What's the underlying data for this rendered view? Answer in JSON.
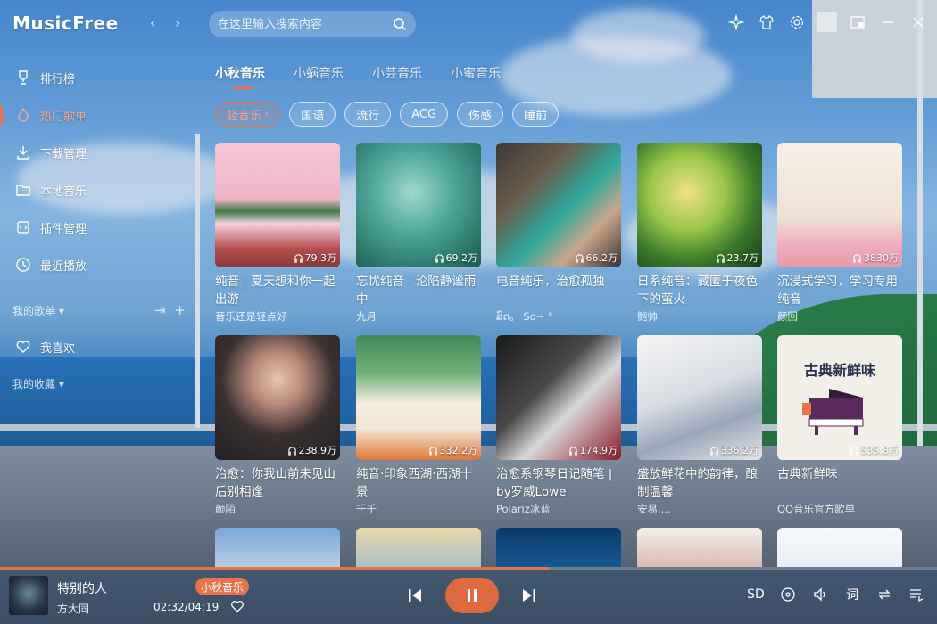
{
  "app": {
    "title": "MusicFree"
  },
  "search": {
    "placeholder": "在这里输入搜索内容"
  },
  "sidebar": {
    "items": [
      {
        "label": "排行榜",
        "icon": "trophy-icon"
      },
      {
        "label": "热门歌单",
        "icon": "flame-icon",
        "active": true
      },
      {
        "label": "下载管理",
        "icon": "download-icon"
      },
      {
        "label": "本地音乐",
        "icon": "folder-icon"
      },
      {
        "label": "插件管理",
        "icon": "plugin-icon"
      },
      {
        "label": "最近播放",
        "icon": "clock-icon"
      }
    ],
    "my_playlists_label": "我的歌单",
    "favorites_label": "我喜欢",
    "my_collections_label": "我的收藏"
  },
  "tabs": [
    {
      "label": "小秋音乐",
      "active": true
    },
    {
      "label": "小蜗音乐"
    },
    {
      "label": "小芸音乐"
    },
    {
      "label": "小蜜音乐"
    }
  ],
  "tags": [
    {
      "label": "轻音乐",
      "active": true,
      "has_arrow": true
    },
    {
      "label": "国语"
    },
    {
      "label": "流行"
    },
    {
      "label": "ACG"
    },
    {
      "label": "伤感"
    },
    {
      "label": "睡前"
    }
  ],
  "playlists": [
    {
      "title": "纯音 | 夏天想和你一起出游",
      "author": "音乐还是轻点好",
      "plays": "79.3万"
    },
    {
      "title": "忘忧纯音 · 沦陷静谧雨中",
      "author": "九月",
      "plays": "69.2万"
    },
    {
      "title": "电音纯乐，治愈孤独",
      "author": "ລົດ。 So~ °",
      "plays": "66.2万"
    },
    {
      "title": "日系纯音：藏匿于夜色下的萤火",
      "author": "鲍帅",
      "plays": "23.7万"
    },
    {
      "title": "沉浸式学习，学习专用纯音",
      "author": "颜回",
      "plays": "3830万"
    },
    {
      "title": "治愈：你我山前未见山后别相逢",
      "author": "颜陌",
      "plays": "238.9万"
    },
    {
      "title": "纯音·印象西湖·西湖十景",
      "author": "千千",
      "plays": "332.2万"
    },
    {
      "title": "治愈系钢琴日记随笔 | by罗威Lowe",
      "author": "Polariz冰蓝",
      "plays": "174.9万"
    },
    {
      "title": "盛放鲜花中的韵律，酿制温馨",
      "author": "安易....",
      "plays": "336.2万"
    },
    {
      "title": "古典新鲜味",
      "author": "QQ音乐官方歌单",
      "plays": "535.8万",
      "cover_text": "古典新鲜味"
    },
    {
      "title": "",
      "author": "",
      "plays": ""
    },
    {
      "title": "",
      "author": "",
      "plays": ""
    },
    {
      "title": "",
      "author": "",
      "plays": ""
    },
    {
      "title": "",
      "author": "",
      "plays": ""
    },
    {
      "title": "",
      "author": "",
      "plays": ""
    }
  ],
  "player": {
    "song_title": "特别的人",
    "artist": "方大同",
    "source": "小秋音乐",
    "time": "02:32/04:19",
    "progress": 0.586,
    "quality": "SD",
    "lyric_label": "词"
  },
  "colors": {
    "accent": "#e8734a"
  }
}
